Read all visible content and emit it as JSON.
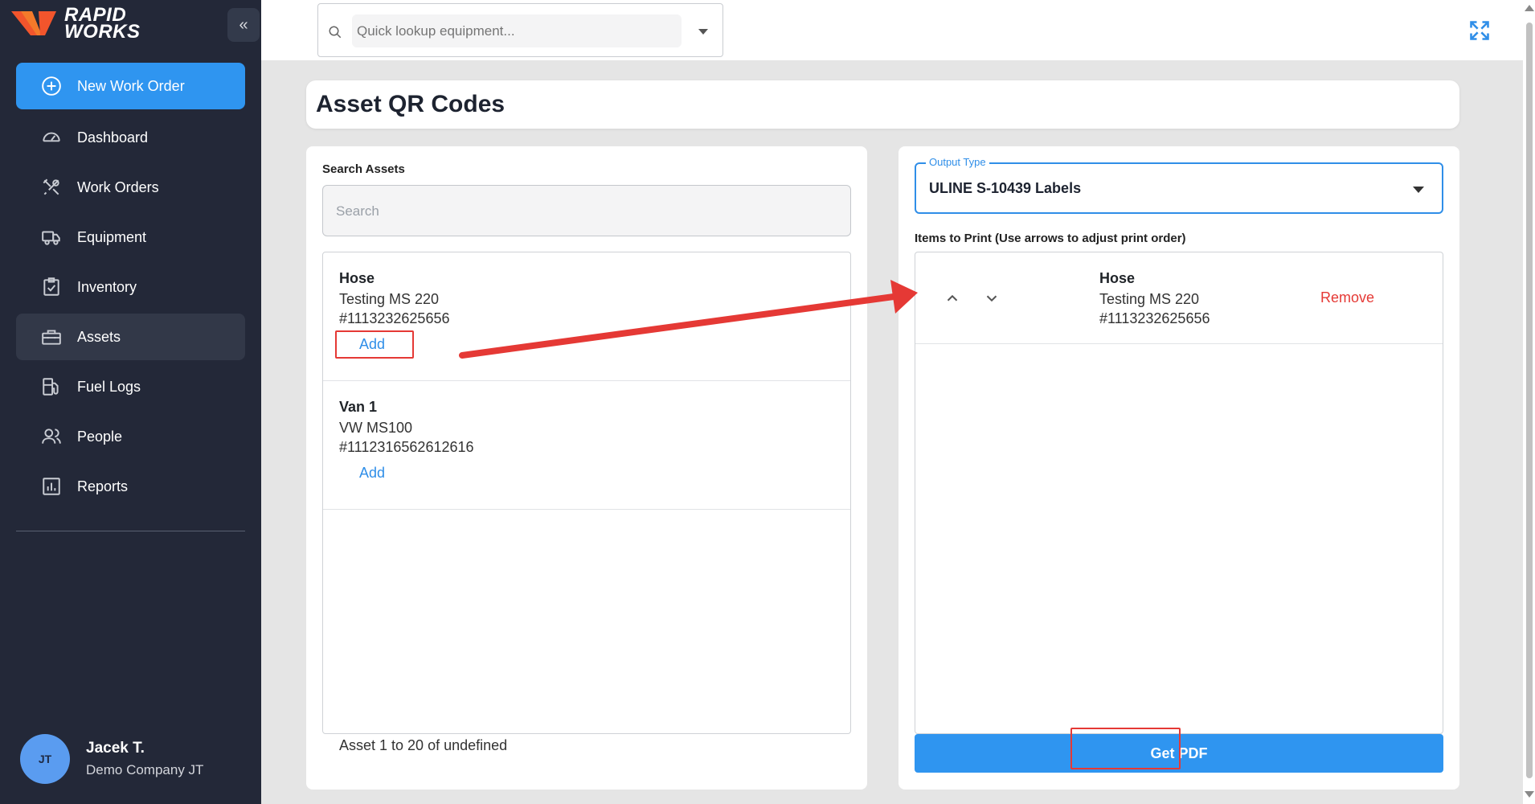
{
  "app": {
    "logo_line1": "RAPID",
    "logo_line2": "WORKS",
    "collapse_label": "«"
  },
  "sidebar": {
    "new_work_order": "New Work Order",
    "items": [
      {
        "label": "Dashboard",
        "icon": "gauge-icon"
      },
      {
        "label": "Work Orders",
        "icon": "tools-icon"
      },
      {
        "label": "Equipment",
        "icon": "truck-icon"
      },
      {
        "label": "Inventory",
        "icon": "clipboard-check-icon"
      },
      {
        "label": "Assets",
        "icon": "toolbox-icon"
      },
      {
        "label": "Fuel Logs",
        "icon": "fuel-pump-icon"
      },
      {
        "label": "People",
        "icon": "people-icon"
      },
      {
        "label": "Reports",
        "icon": "chart-icon"
      }
    ],
    "active": "Assets"
  },
  "user": {
    "initials": "JT",
    "name": "Jacek T.",
    "company": "Demo Company JT"
  },
  "topbar": {
    "lookup_placeholder": "Quick lookup equipment..."
  },
  "page": {
    "title": "Asset QR Codes"
  },
  "left_panel": {
    "search_label": "Search Assets",
    "search_placeholder": "Search",
    "assets": [
      {
        "name": "Hose",
        "model": "Testing MS 220",
        "number": "#1113232625656",
        "action": "Add"
      },
      {
        "name": "Van 1",
        "model": "VW MS100",
        "number": "#1112316562612616",
        "action": "Add"
      }
    ],
    "pager": "Asset 1 to 20 of undefined"
  },
  "right_panel": {
    "output_legend": "Output Type",
    "output_value": "ULINE S-10439 Labels",
    "items_label": "Items to Print (Use arrows to adjust print order)",
    "items": [
      {
        "name": "Hose",
        "model": "Testing MS 220",
        "number": "#1113232625656",
        "action": "Remove"
      }
    ],
    "pdf_button": "Get PDF"
  },
  "colors": {
    "sidebar_bg": "#232838",
    "accent": "#2f95f0",
    "danger": "#e53935",
    "annotation": "#e53935"
  }
}
